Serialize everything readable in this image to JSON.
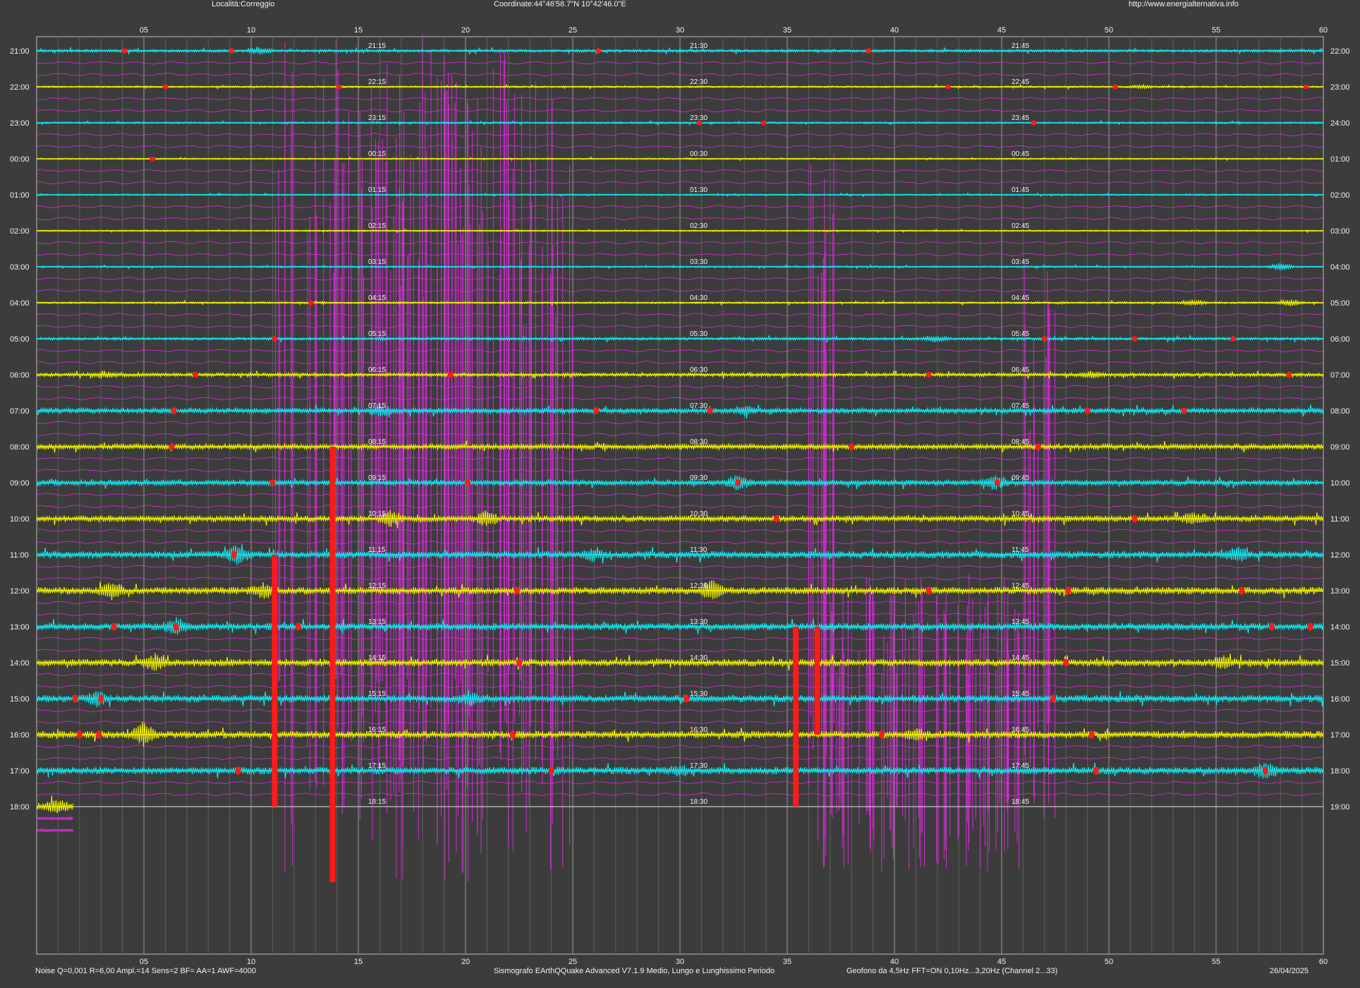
{
  "header": {
    "location": "Località:Correggio",
    "coordinates": "Coordinate:44°46'58.7\"N  10°42'46.0\"E",
    "website": "http://www.energialternativa.info"
  },
  "footer": {
    "settings": "Noise Q=0,001 R=6,00 Ampl.=14 Sens=2 BF= AA=1 AWF=4000",
    "software": "Sismografo  EArthQQuake Advanced V7.1.9  Medio, Lungo e Lunghissimo Periodo",
    "sensor": "Geofono da 4,5Hz FFT=ON 0,10Hz...3,20Hz      (Channel 2...33)",
    "date": "26/04/2025"
  },
  "chart_data": {
    "type": "line",
    "title": "",
    "x_axis": {
      "label": "",
      "range": [
        0,
        60
      ],
      "ticks": [
        "05",
        "10",
        "15",
        "20",
        "25",
        "30",
        "35",
        "40",
        "45",
        "50",
        "55",
        "60"
      ],
      "tick_values": [
        5,
        10,
        15,
        20,
        25,
        30,
        35,
        40,
        45,
        50,
        55,
        60
      ]
    },
    "grid": true,
    "trace_colors": [
      "#17e6f0",
      "#f0f000"
    ],
    "event_color": "#ff1a1a",
    "fft_color": "#e02ce0",
    "rows": [
      {
        "left": "21:00",
        "right": "22:00",
        "q1": "21:15",
        "q2": "21:30",
        "q3": "21:45",
        "color": "#17e6f0",
        "amp": 1.5,
        "events": [
          4.1,
          9.1,
          26.2,
          38.8
        ],
        "bursts": [
          [
            10.4,
            5
          ]
        ]
      },
      {
        "left": "22:00",
        "right": "23:00",
        "q1": "22:15",
        "q2": "22:30",
        "q3": "22:45",
        "color": "#f0f000",
        "amp": 1.0,
        "events": [
          6.0,
          14.1,
          42.5,
          50.3,
          59.2
        ],
        "bursts": [
          [
            51.5,
            2
          ]
        ]
      },
      {
        "left": "23:00",
        "right": "24:00",
        "q1": "23:15",
        "q2": "23:30",
        "q3": "23:45",
        "color": "#17e6f0",
        "amp": 1.0,
        "events": [
          30.9,
          33.9,
          46.5
        ],
        "bursts": []
      },
      {
        "left": "00:00",
        "right": "01:00",
        "q1": "00:15",
        "q2": "00:30",
        "q3": "00:45",
        "color": "#f0f000",
        "amp": 0.8,
        "events": [
          5.4
        ],
        "bursts": []
      },
      {
        "left": "01:00",
        "right": "02:00",
        "q1": "01:15",
        "q2": "01:30",
        "q3": "01:45",
        "color": "#17e6f0",
        "amp": 0.8,
        "events": [],
        "bursts": []
      },
      {
        "left": "02:00",
        "right": "03:00",
        "q1": "02:15",
        "q2": "02:30",
        "q3": "02:45",
        "color": "#f0f000",
        "amp": 0.8,
        "events": [],
        "bursts": []
      },
      {
        "left": "03:00",
        "right": "04:00",
        "q1": "03:15",
        "q2": "03:30",
        "q3": "03:45",
        "color": "#17e6f0",
        "amp": 0.9,
        "events": [],
        "bursts": [
          [
            58.0,
            5
          ]
        ]
      },
      {
        "left": "04:00",
        "right": "05:00",
        "q1": "04:15",
        "q2": "04:30",
        "q3": "04:45",
        "color": "#f0f000",
        "amp": 1.1,
        "events": [
          12.8
        ],
        "bursts": [
          [
            54.0,
            4
          ],
          [
            58.5,
            4
          ]
        ]
      },
      {
        "left": "05:00",
        "right": "06:00",
        "q1": "05:15",
        "q2": "05:30",
        "q3": "05:45",
        "color": "#17e6f0",
        "amp": 1.5,
        "events": [
          11.1,
          47.0,
          51.2,
          55.8
        ],
        "bursts": [
          [
            42.0,
            4
          ]
        ]
      },
      {
        "left": "06:00",
        "right": "07:00",
        "q1": "06:15",
        "q2": "06:30",
        "q3": "06:45",
        "color": "#f0f000",
        "amp": 2.0,
        "events": [
          7.4,
          19.3,
          41.6,
          58.4
        ],
        "bursts": [
          [
            3.2,
            4
          ],
          [
            49.2,
            4
          ]
        ]
      },
      {
        "left": "07:00",
        "right": "08:00",
        "q1": "07:15",
        "q2": "07:30",
        "q3": "07:45",
        "color": "#17e6f0",
        "amp": 3.0,
        "events": [
          6.4,
          26.1,
          31.4,
          49.0,
          53.5
        ],
        "bursts": [
          [
            16.0,
            6
          ],
          [
            33.0,
            5
          ]
        ]
      },
      {
        "left": "08:00",
        "right": "09:00",
        "q1": "08:15",
        "q2": "08:30",
        "q3": "08:45",
        "color": "#f0f000",
        "amp": 3.0,
        "events": [
          6.3,
          38.0,
          46.7
        ],
        "bursts": []
      },
      {
        "left": "09:00",
        "right": "10:00",
        "q1": "09:15",
        "q2": "09:30",
        "q3": "09:45",
        "color": "#17e6f0",
        "amp": 3.2,
        "events": [
          11.0,
          20.1,
          32.7,
          44.8
        ],
        "bursts": [
          [
            32.7,
            9
          ],
          [
            44.7,
            10
          ]
        ]
      },
      {
        "left": "10:00",
        "right": "11:00",
        "q1": "10:15",
        "q2": "10:30",
        "q3": "10:45",
        "color": "#f0f000",
        "amp": 3.5,
        "events": [
          34.5,
          51.2
        ],
        "bursts": [
          [
            16.5,
            8
          ],
          [
            21.0,
            8
          ],
          [
            53.9,
            6
          ]
        ]
      },
      {
        "left": "11:00",
        "right": "12:00",
        "q1": "11:15",
        "q2": "11:30",
        "q3": "11:45",
        "color": "#17e6f0",
        "amp": 4.0,
        "events": [
          9.2
        ],
        "bursts": [
          [
            9.3,
            12
          ],
          [
            26.0,
            7
          ],
          [
            56.0,
            8
          ]
        ]
      },
      {
        "left": "12:00",
        "right": "13:00",
        "q1": "12:15",
        "q2": "12:30",
        "q3": "12:45",
        "color": "#f0f000",
        "amp": 4.0,
        "events": [
          22.4,
          41.6,
          48.1,
          56.2
        ],
        "bursts": [
          [
            3.5,
            10
          ],
          [
            31.5,
            12
          ],
          [
            10.6,
            8
          ]
        ]
      },
      {
        "left": "13:00",
        "right": "14:00",
        "q1": "13:15",
        "q2": "13:30",
        "q3": "13:45",
        "color": "#17e6f0",
        "amp": 4.0,
        "events": [
          3.6,
          6.5,
          12.2,
          57.6,
          59.4
        ],
        "bursts": [
          [
            6.5,
            10
          ]
        ]
      },
      {
        "left": "14:00",
        "right": "15:00",
        "q1": "14:15",
        "q2": "14:30",
        "q3": "14:45",
        "color": "#f0f000",
        "amp": 4.0,
        "events": [
          22.5,
          48.0
        ],
        "bursts": [
          [
            5.5,
            8
          ],
          [
            55.3,
            6
          ]
        ]
      },
      {
        "left": "15:00",
        "right": "16:00",
        "q1": "15:15",
        "q2": "15:30",
        "q3": "15:45",
        "color": "#17e6f0",
        "amp": 4.0,
        "events": [
          1.8,
          3.0,
          30.3,
          47.4
        ],
        "bursts": [
          [
            2.8,
            10
          ],
          [
            20.2,
            7
          ]
        ]
      },
      {
        "left": "16:00",
        "right": "17:00",
        "q1": "16:15",
        "q2": "16:30",
        "q3": "16:45",
        "color": "#f0f000",
        "amp": 4.0,
        "events": [
          2.0,
          2.9,
          22.2,
          39.4,
          49.2
        ],
        "bursts": [
          [
            5.0,
            14
          ],
          [
            41.0,
            6
          ]
        ]
      },
      {
        "left": "17:00",
        "right": "18:00",
        "q1": "17:15",
        "q2": "17:30",
        "q3": "17:45",
        "color": "#17e6f0",
        "amp": 4.0,
        "events": [
          9.4,
          24.0,
          49.4,
          57.3
        ],
        "bursts": [
          [
            57.3,
            10
          ],
          [
            30.0,
            5
          ]
        ]
      },
      {
        "left": "18:00",
        "right": "19:00",
        "q1": "18:15",
        "q2": "18:30",
        "q3": "18:45",
        "color": "#f0f000",
        "amp": 4.0,
        "events": [],
        "bursts": [
          [
            0.9,
            6
          ]
        ],
        "end_minute": 1.7
      }
    ],
    "large_events": [
      {
        "minute": 11.1,
        "from_row": 14,
        "to_row": 21
      },
      {
        "minute": 13.8,
        "from_row": 11,
        "to_row": 23.1
      },
      {
        "minute": 35.4,
        "from_row": 16,
        "to_row": 21
      },
      {
        "minute": 36.4,
        "from_row": 16,
        "to_row": 19
      }
    ],
    "fft_bands": [
      {
        "start": 11.0,
        "end": 25.0,
        "from_row": -0.5,
        "to_row": 23.1
      },
      {
        "start": 35.4,
        "end": 37.2,
        "from_row": 2.8,
        "to_row": 22.8
      },
      {
        "start": 46.0,
        "end": 47.5,
        "from_row": 5.5,
        "to_row": 22.0
      },
      {
        "start": 37.0,
        "end": 46.0,
        "from_row": 14.5,
        "to_row": 22.8
      }
    ]
  }
}
